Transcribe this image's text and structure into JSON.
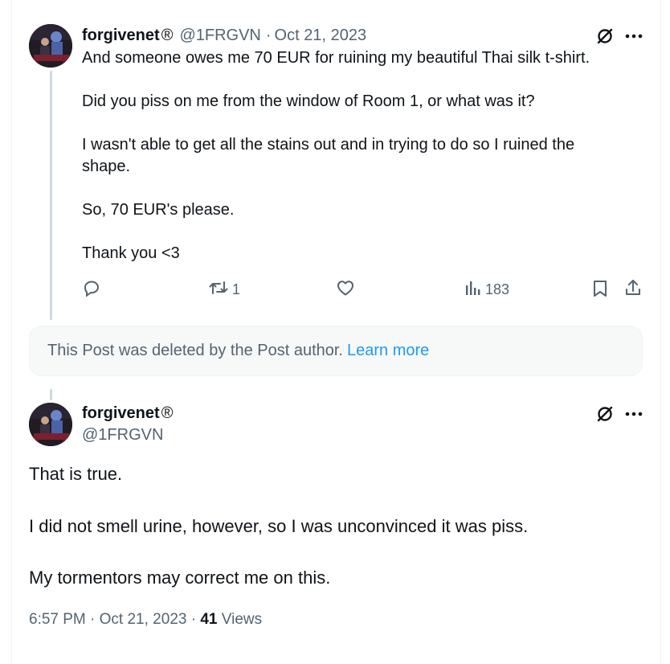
{
  "reply_tweet": {
    "author_name": "forgivenet",
    "author_badge": "®",
    "handle": "@1FRGVN",
    "separator": "·",
    "date": "Oct 21, 2023",
    "text": "And someone owes me 70 EUR for ruining my beautiful Thai silk t-shirt.\n\nDid you piss on me from the window of Room 1, or what was it?\n\nI wasn't able to get all the stains out and in trying to do so I ruined the\nshape.\n\nSo, 70 EUR's please.\n\nThank you <3",
    "actions": {
      "reply_count": "",
      "repost_count": "1",
      "like_count": "",
      "views_count": "183"
    },
    "icons": [
      "grok-icon",
      "more-icon",
      "reply-icon",
      "repost-icon",
      "like-icon",
      "views-icon",
      "bookmark-icon",
      "share-icon"
    ]
  },
  "deleted_notice": {
    "text": "This Post was deleted by the Post author.",
    "link": "Learn more"
  },
  "main_tweet": {
    "author_name": "forgivenet",
    "author_badge": "®",
    "handle": "@1FRGVN",
    "paragraphs": [
      "That is true.",
      "I did not smell urine, however, so I was unconvinced it was piss.",
      "My tormentors may correct me on this."
    ],
    "time": "6:57 PM",
    "separator": "·",
    "date": "Oct 21, 2023",
    "separator2": "·",
    "views_count": "41",
    "views_label": "Views"
  },
  "colors": {
    "text": "#0f1419",
    "secondary": "#536471",
    "link": "#1d9bf0",
    "thread_line": "#cfd9de",
    "deleted_bg": "#f7f9f9"
  }
}
